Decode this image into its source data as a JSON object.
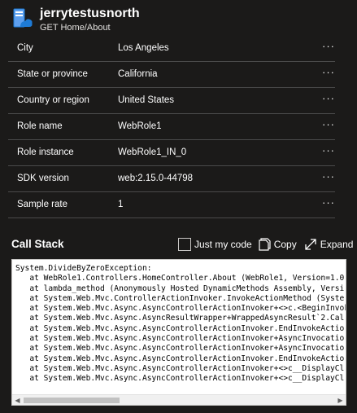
{
  "header": {
    "title": "jerrytestusnorth",
    "subtitle": "GET Home/About"
  },
  "properties": [
    {
      "name": "City",
      "value": "Los Angeles",
      "more": "···"
    },
    {
      "name": "State or province",
      "value": "California",
      "more": "···"
    },
    {
      "name": "Country or region",
      "value": "United States",
      "more": "···"
    },
    {
      "name": "Role name",
      "value": "WebRole1",
      "more": "···"
    },
    {
      "name": "Role instance",
      "value": "WebRole1_IN_0",
      "more": "···"
    },
    {
      "name": "SDK version",
      "value": "web:2.15.0-44798",
      "more": "···"
    },
    {
      "name": "Sample rate",
      "value": "1",
      "more": "···"
    }
  ],
  "callstack": {
    "title": "Call Stack",
    "just_my_code_label": "Just my code",
    "copy_label": "Copy",
    "expand_label": "Expand",
    "text": "System.DivideByZeroException:\n   at WebRole1.Controllers.HomeController.About (WebRole1, Version=1.0\n   at lambda_method (Anonymously Hosted DynamicMethods Assembly, Versi\n   at System.Web.Mvc.ControllerActionInvoker.InvokeActionMethod (Syste\n   at System.Web.Mvc.Async.AsyncControllerActionInvoker+<>c.<BeginInvok\n   at System.Web.Mvc.Async.AsyncResultWrapper+WrappedAsyncResult`2.Cal\n   at System.Web.Mvc.Async.AsyncControllerActionInvoker.EndInvokeActio\n   at System.Web.Mvc.Async.AsyncControllerActionInvoker+AsyncInvocatio\n   at System.Web.Mvc.Async.AsyncControllerActionInvoker+AsyncInvocatio\n   at System.Web.Mvc.Async.AsyncControllerActionInvoker.EndInvokeActio\n   at System.Web.Mvc.Async.AsyncControllerActionInvoker+<>c__DisplayCl\n   at System.Web.Mvc.Async.AsyncControllerActionInvoker+<>c__DisplayCl"
  },
  "icons": {
    "app": "server-cloud-icon",
    "copy": "copy-icon",
    "expand": "expand-icon"
  },
  "colors": {
    "background": "#1b1a19",
    "icon_blue": "#1e7bd6",
    "divider": "#4a4a4a"
  }
}
